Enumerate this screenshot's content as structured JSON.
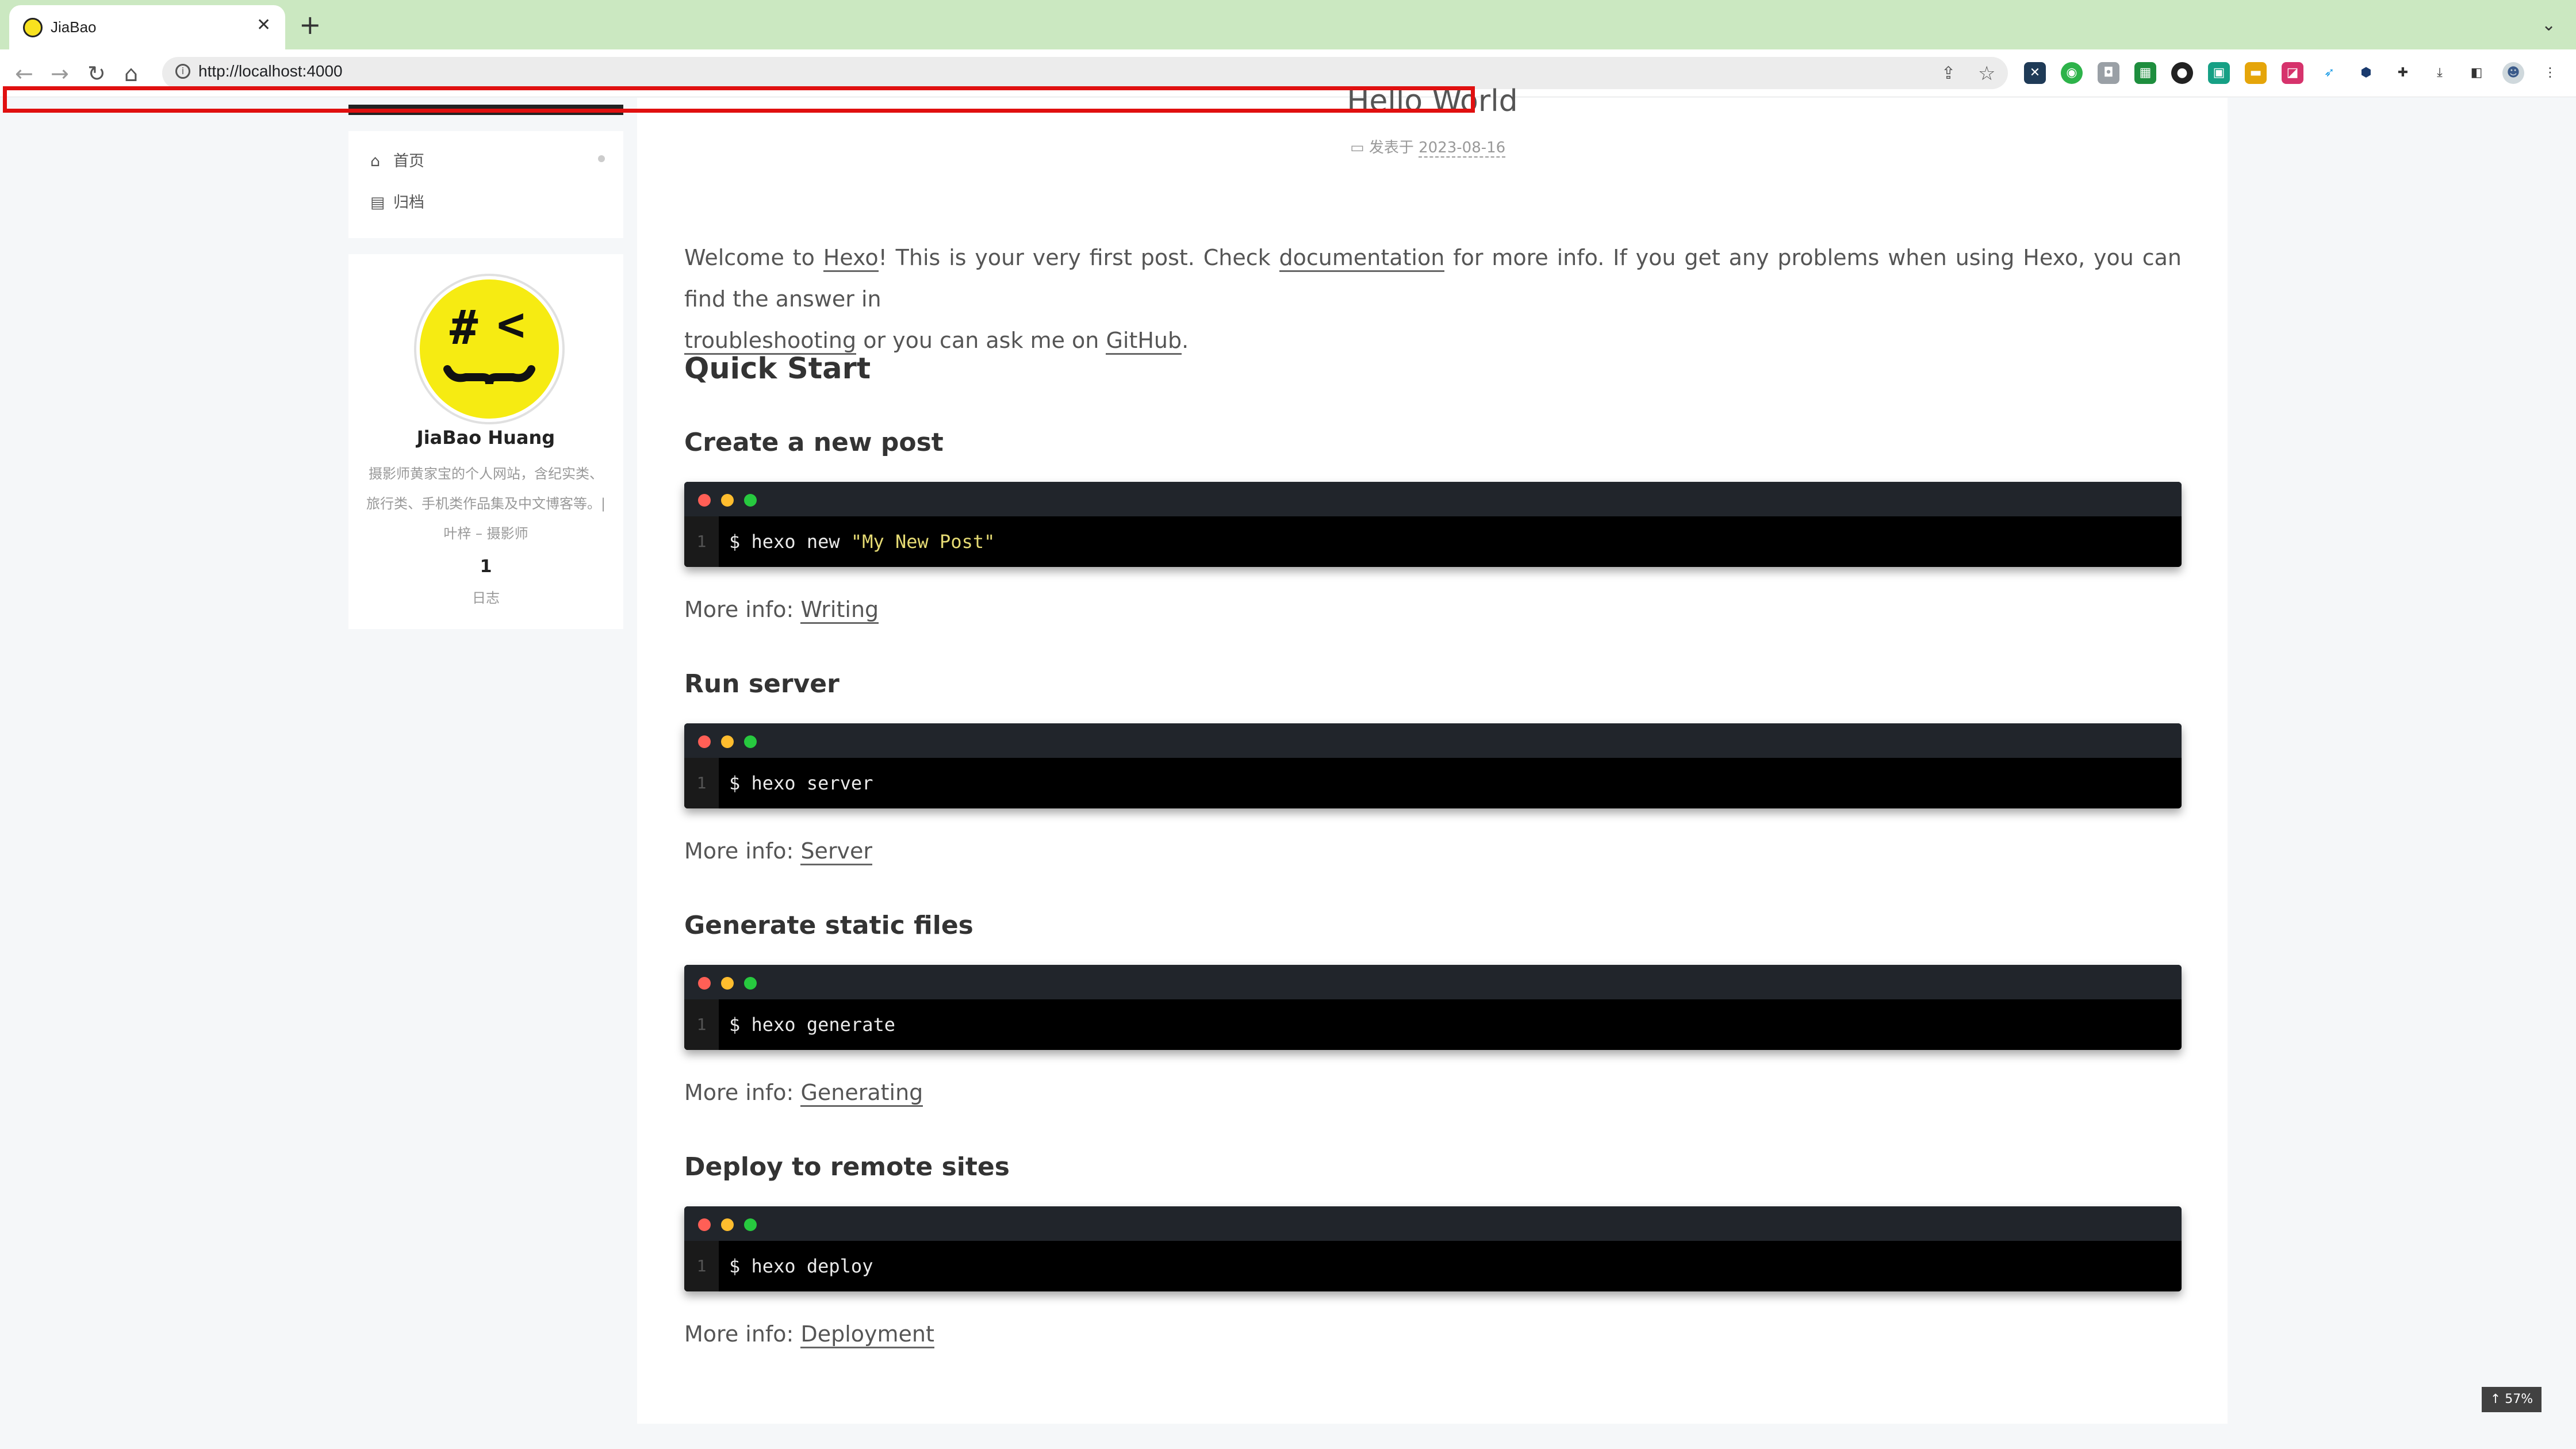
{
  "browser": {
    "tab_title": "JiaBao",
    "tab_close": "✕",
    "new_tab": "+",
    "collapse": "⌄",
    "url": "http://localhost:4000",
    "nav_icons": [
      "back-icon",
      "forward-icon",
      "reload-icon",
      "home-icon"
    ],
    "extension_icons": [
      "share-icon",
      "bookmark-star-icon",
      "x-extension-icon",
      "green-extension-icon",
      "camera-extension-icon",
      "on-extension-icon",
      "badge-extension-icon",
      "green-square-extension-icon",
      "folder-extension-icon",
      "pink-extension-icon",
      "bird-extension-icon",
      "hexagon-extension-icon",
      "puzzle-icon",
      "download-icon",
      "sidepanel-icon",
      "profile-avatar",
      "menu-kebab-icon"
    ],
    "accent_color": "#cbe8c1"
  },
  "sidebar": {
    "menu": [
      {
        "label": "首页",
        "icon": "home-icon"
      },
      {
        "label": "归档",
        "icon": "archive-icon"
      }
    ],
    "author_name": "JiaBao Huang",
    "description": "摄影师黄家宝的个人网站，含纪实类、旅行类、手机类作品集及中文博客等。| 叶梓 – 摄影师",
    "post_count": "1",
    "post_count_label": "日志"
  },
  "post": {
    "title": "Hello World",
    "meta_label": "发表于",
    "date": "2023-08-16",
    "intro": {
      "t1": "Welcome to ",
      "link1": "Hexo",
      "t2": "! This is your very first post. Check ",
      "link2": "documentation",
      "t3": " for more info. If you get any problems when using Hexo, you can find the answer in",
      "link3": "troubleshooting",
      "t4": " or you can ask me on ",
      "link4": "GitHub",
      "t5": "."
    },
    "quick_start": "Quick Start",
    "sections": [
      {
        "heading": "Create a new post",
        "cmd": "$ hexo new ",
        "cmd_str": "\"My New Post\"",
        "more": "More info: ",
        "link": "Writing"
      },
      {
        "heading": "Run server",
        "cmd": "$ hexo server",
        "cmd_str": "",
        "more": "More info: ",
        "link": "Server"
      },
      {
        "heading": "Generate static files",
        "cmd": "$ hexo generate",
        "cmd_str": "",
        "more": "More info: ",
        "link": "Generating"
      },
      {
        "heading": "Deploy to remote sites",
        "cmd": "$ hexo deploy",
        "cmd_str": "",
        "more": "More info: ",
        "link": "Deployment"
      }
    ],
    "line_number": "1"
  },
  "back_to_top": "↑ 57%",
  "colors": {
    "dot_red": "#ff5f56",
    "dot_yellow": "#ffbd2e",
    "dot_green": "#27c93f",
    "annotation": "#e01010"
  }
}
